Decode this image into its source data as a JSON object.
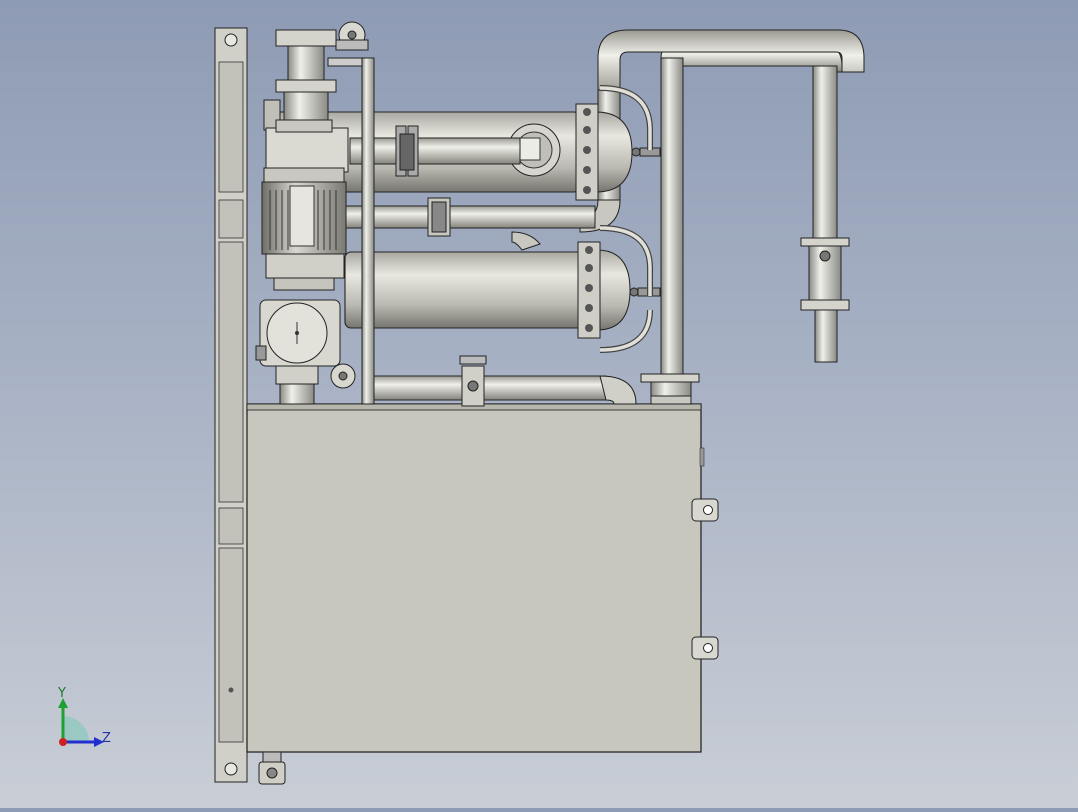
{
  "app": {
    "view": "cad-model-viewport"
  },
  "triad": {
    "y_label": "Y",
    "z_label": "Z"
  },
  "colors": {
    "metal": "#c8c8c0",
    "metal_dark": "#7c7c74",
    "metal_light": "#ecece6",
    "tank": "#c6c5bb",
    "outline": "#1a1a1a",
    "axis_y": "#1fa033",
    "axis_z": "#1f2fd0",
    "axis_x": "#d02020"
  },
  "model": {
    "name_shown": "",
    "components": [
      "support-frame",
      "tank",
      "motor-pump",
      "upper-filter-vessel",
      "lower-filter-vessel",
      "piping",
      "valves",
      "flanges",
      "lifting-lugs"
    ]
  }
}
